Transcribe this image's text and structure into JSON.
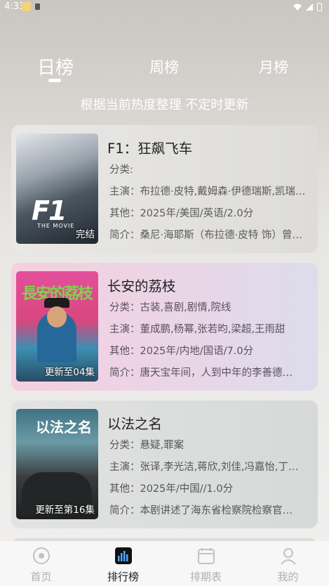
{
  "status_bar": {
    "time": "4:33"
  },
  "tabs": {
    "day": "日榜",
    "week": "周榜",
    "month": "月榜"
  },
  "subtitle": "根据当前热度整理 不定时更新",
  "items": [
    {
      "title": "F1：狂飙飞车",
      "category": "分类:",
      "cast": "主演：布拉德·皮特,戴姆森·伊德瑞斯,凯瑞…",
      "other": "其他：2025年/美国/英语/2.0分",
      "intro": "简介：桑尼·海耶斯（布拉德·皮特 饰）曾…",
      "poster_label": "完结",
      "poster_text": "F1",
      "poster_sub": "THE MOVIE"
    },
    {
      "title": "长安的荔枝",
      "category": "分类：古装,喜剧,剧情,院线",
      "cast": "主演：董成鹏,杨幂,张若昀,梁超,王雨甜",
      "other": "其他：2025年/内地/国语/7.0分",
      "intro": "简介：唐天宝年间，人到中年的李善德…",
      "poster_label": "更新至04集",
      "poster_text": "長安的荔枝"
    },
    {
      "title": "以法之名",
      "category": "分类：悬疑,罪案",
      "cast": "主演：张译,李光洁,蒋欣,刘佳,冯嘉怡,丁…",
      "other": "其他：2025年/中国//1.0分",
      "intro": "简介：本剧讲述了海东省检察院检察官…",
      "poster_label": "更新至第16集",
      "poster_text": "以法之名"
    }
  ],
  "nav": {
    "home": "首页",
    "rank": "排行榜",
    "schedule": "排期表",
    "me": "我的"
  }
}
